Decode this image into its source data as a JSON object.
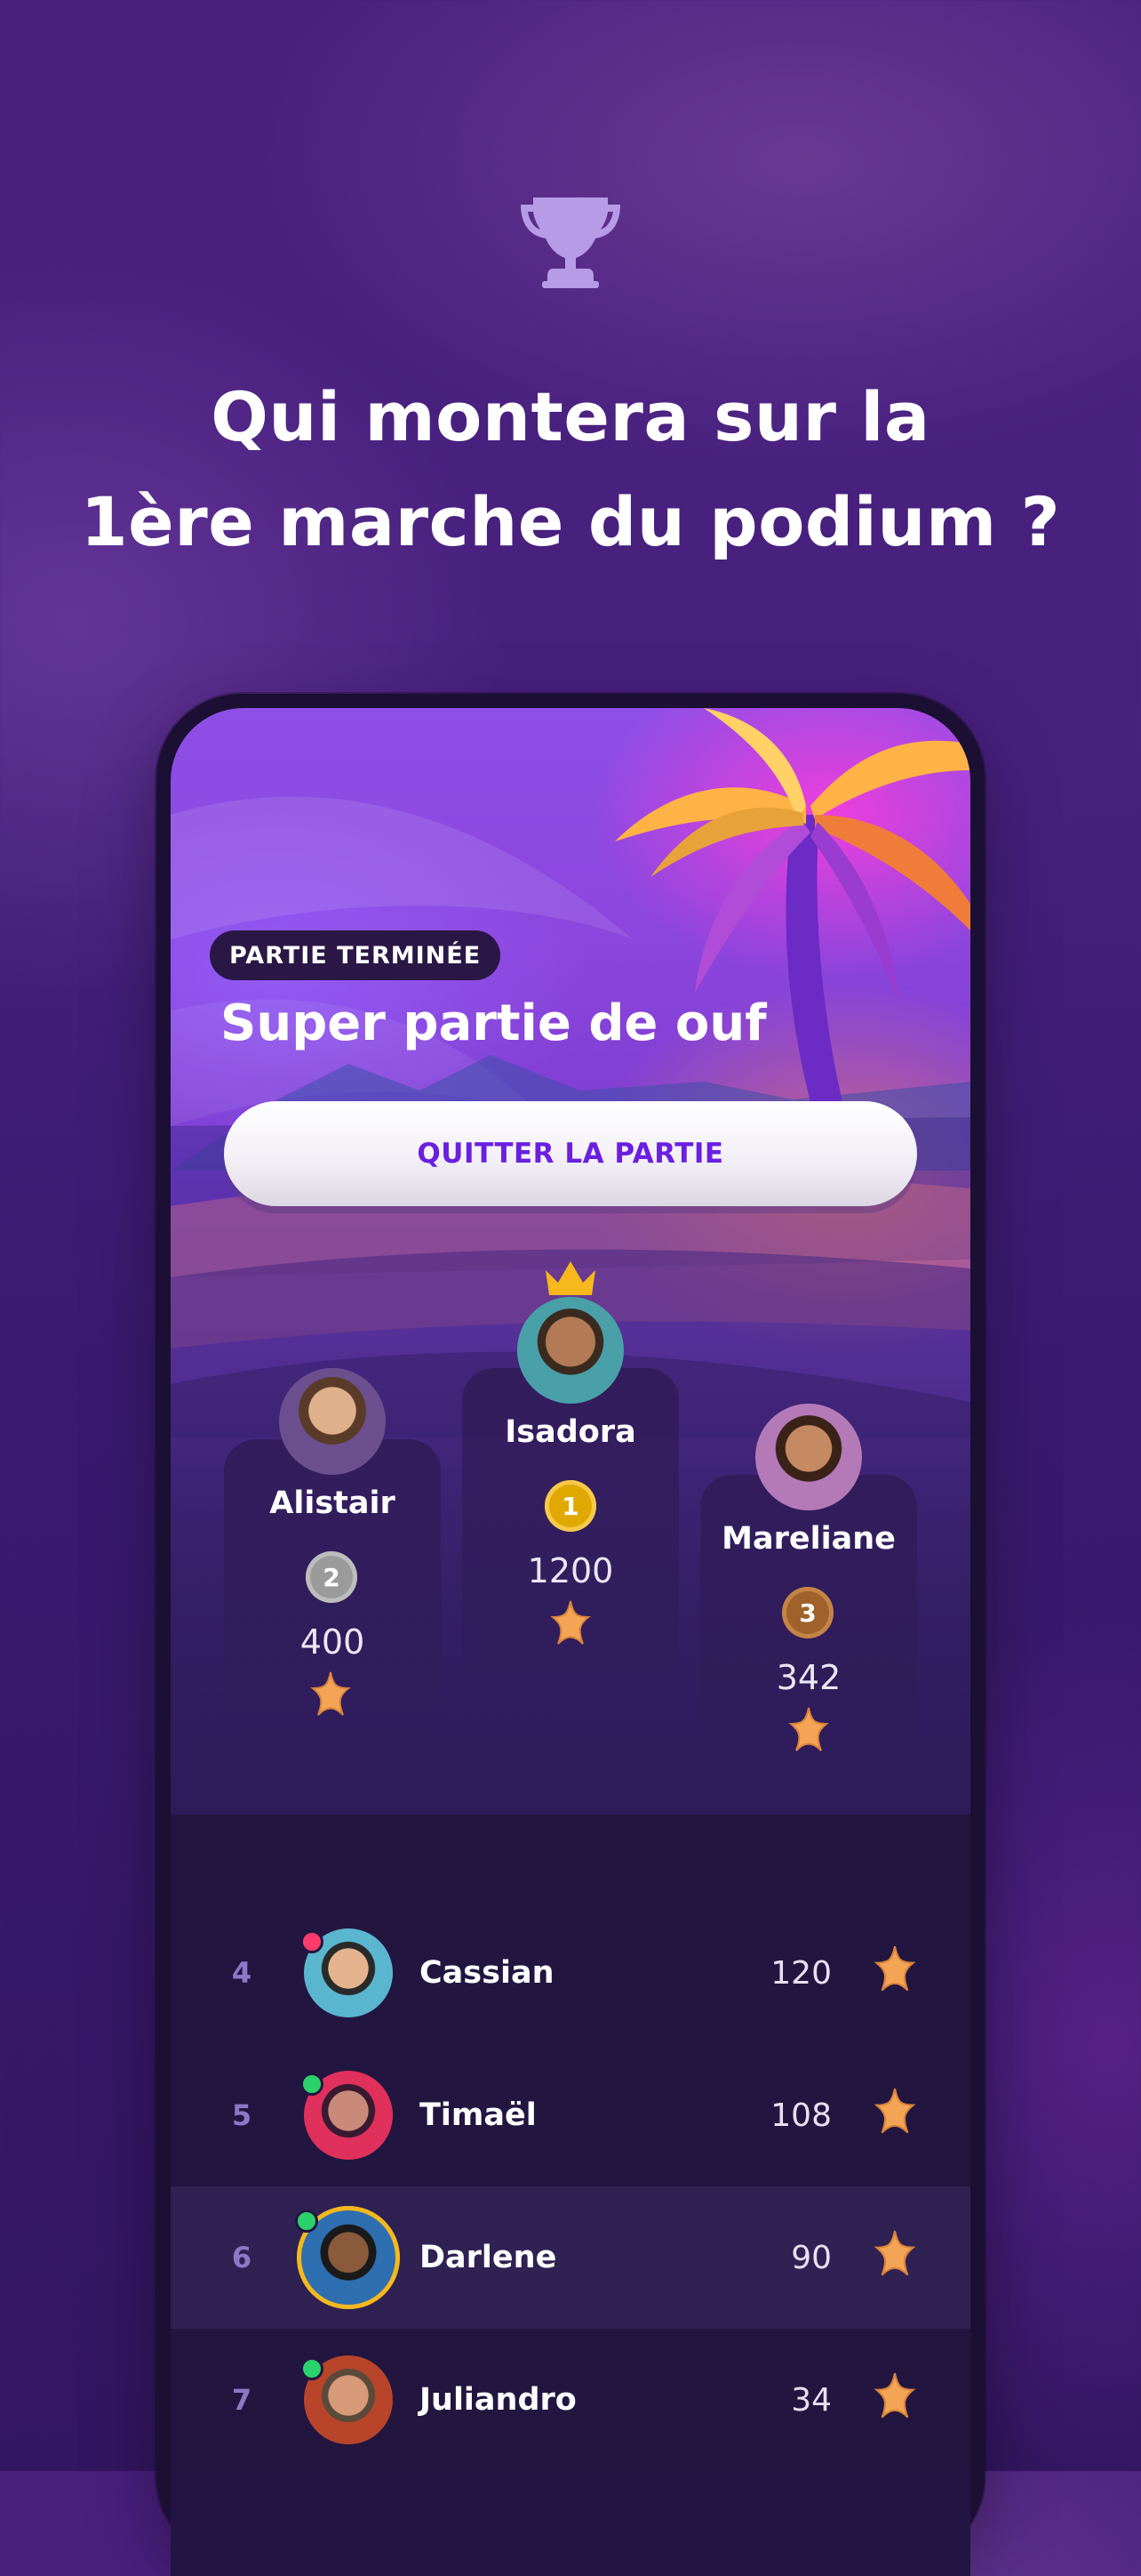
{
  "headline": {
    "line1": "Qui montera sur la",
    "line2": "1ère marche du podium ?"
  },
  "game": {
    "status": "PARTIE TERMINÉE",
    "title": "Super partie de ouf",
    "quit_label": "QUITTER LA PARTIE"
  },
  "podium": [
    {
      "name": "Alistair",
      "rank": "2",
      "score": "400"
    },
    {
      "name": "Isadora",
      "rank": "1",
      "score": "1200"
    },
    {
      "name": "Mareliane",
      "rank": "3",
      "score": "342"
    }
  ],
  "leaderboard": [
    {
      "rank": "4",
      "name": "Cassian",
      "score": "120",
      "status": "offline"
    },
    {
      "rank": "5",
      "name": "Timaël",
      "score": "108",
      "status": "online"
    },
    {
      "rank": "6",
      "name": "Darlene",
      "score": "90",
      "status": "online",
      "current_user": true
    },
    {
      "rank": "7",
      "name": "Juliandro",
      "score": "34",
      "status": "online"
    }
  ],
  "colors": {
    "accent": "#6a1fe0",
    "gold": "#e8b400",
    "silver": "#9b9b9b",
    "bronze": "#a0622a",
    "online": "#2bd16b",
    "offline": "#ff3b6b",
    "star": "#f4a455"
  },
  "icons": {
    "trophy": "trophy-icon",
    "crown": "crown-icon",
    "star": "starfish-icon"
  }
}
